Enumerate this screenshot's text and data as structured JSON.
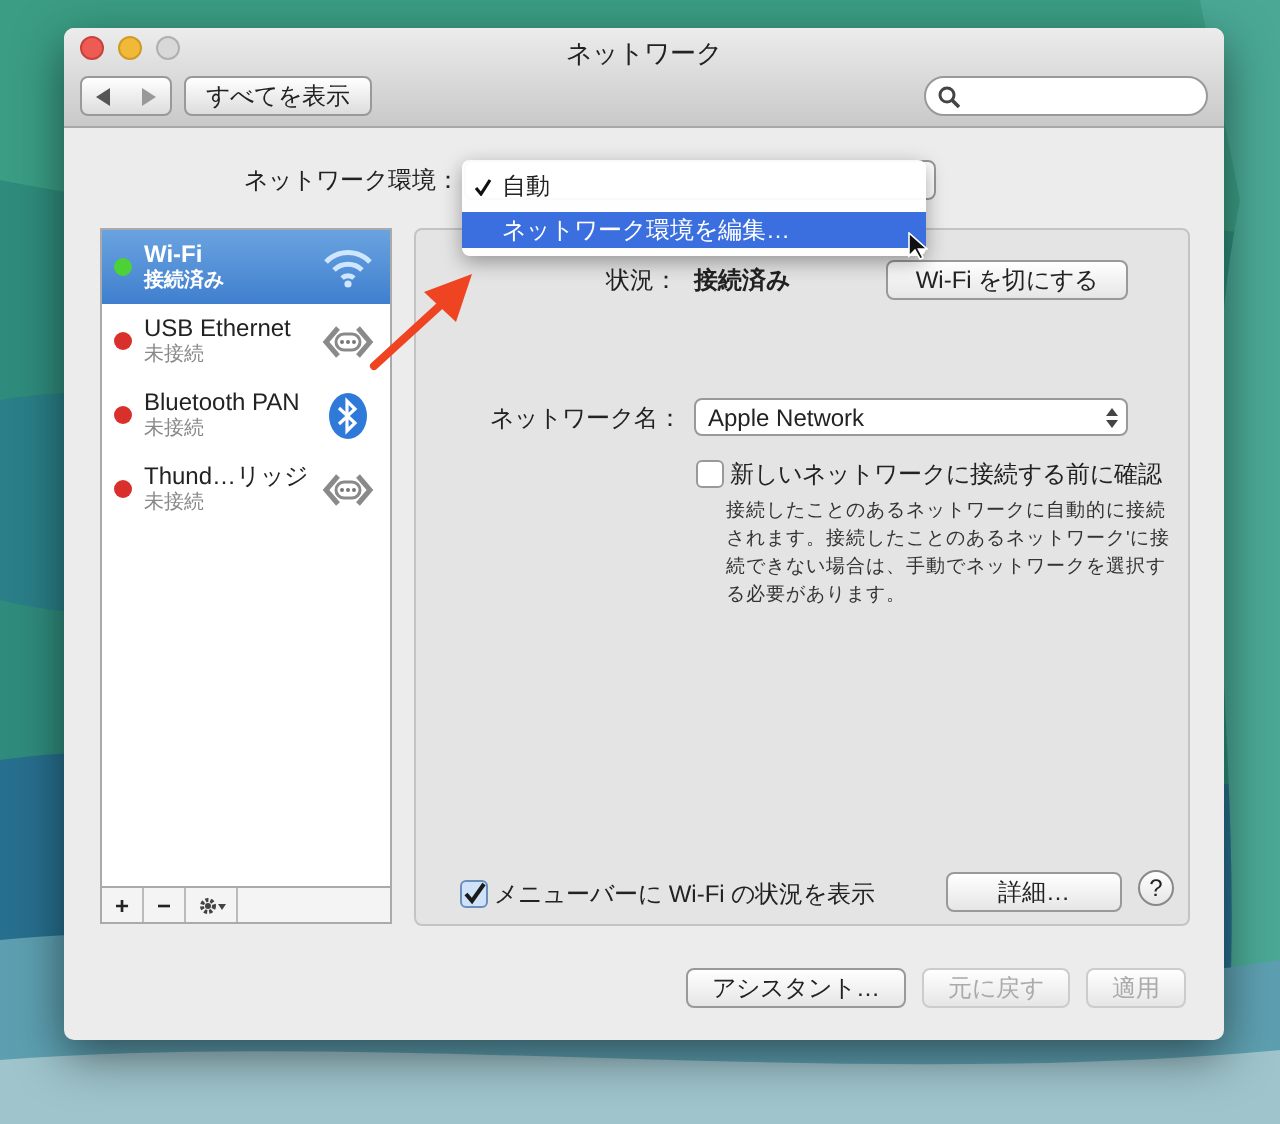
{
  "window": {
    "title": "ネットワーク"
  },
  "toolbar": {
    "show_all": "すべてを表示"
  },
  "location": {
    "label": "ネットワーク環境：",
    "menu": [
      {
        "label": "自動",
        "checked": true,
        "selected": false
      },
      {
        "label": "ネットワーク環境を編集…",
        "checked": false,
        "selected": true
      }
    ]
  },
  "services": [
    {
      "name": "Wi-Fi",
      "status": "接続済み",
      "color": "#4cd137",
      "kind": "wifi",
      "selected": true
    },
    {
      "name": "USB Ethernet",
      "status": "未接続",
      "color": "#d9302c",
      "kind": "ethernet",
      "selected": false
    },
    {
      "name": "Bluetooth PAN",
      "status": "未接続",
      "color": "#d9302c",
      "kind": "bluetooth",
      "selected": false
    },
    {
      "name": "Thund…リッジ",
      "status": "未接続",
      "color": "#d9302c",
      "kind": "ethernet",
      "selected": false
    }
  ],
  "list_toolbar": [
    "+",
    "−"
  ],
  "detail": {
    "status_label": "状況：",
    "status_value": "接続済み",
    "toggle_button": "Wi-Fi を切にする",
    "network_name_label": "ネットワーク名：",
    "network_name": "Apple Network",
    "ask_checkbox": {
      "label": "新しいネットワークに接続する前に確認",
      "checked": false
    },
    "description": "接続したことのあるネットワークに自動的に接続されます。接続したことのあるネットワーク'に接続できない場合は、手動でネットワークを選択する必要があります。",
    "show_in_menu": {
      "label": "メニューバーに Wi-Fi の状況を表示",
      "checked": true
    },
    "advanced_button": "詳細…",
    "help": "?"
  },
  "footer_buttons": [
    {
      "label": "アシスタント…",
      "disabled": false
    },
    {
      "label": "元に戻す",
      "disabled": true
    },
    {
      "label": "適用",
      "disabled": true
    }
  ]
}
